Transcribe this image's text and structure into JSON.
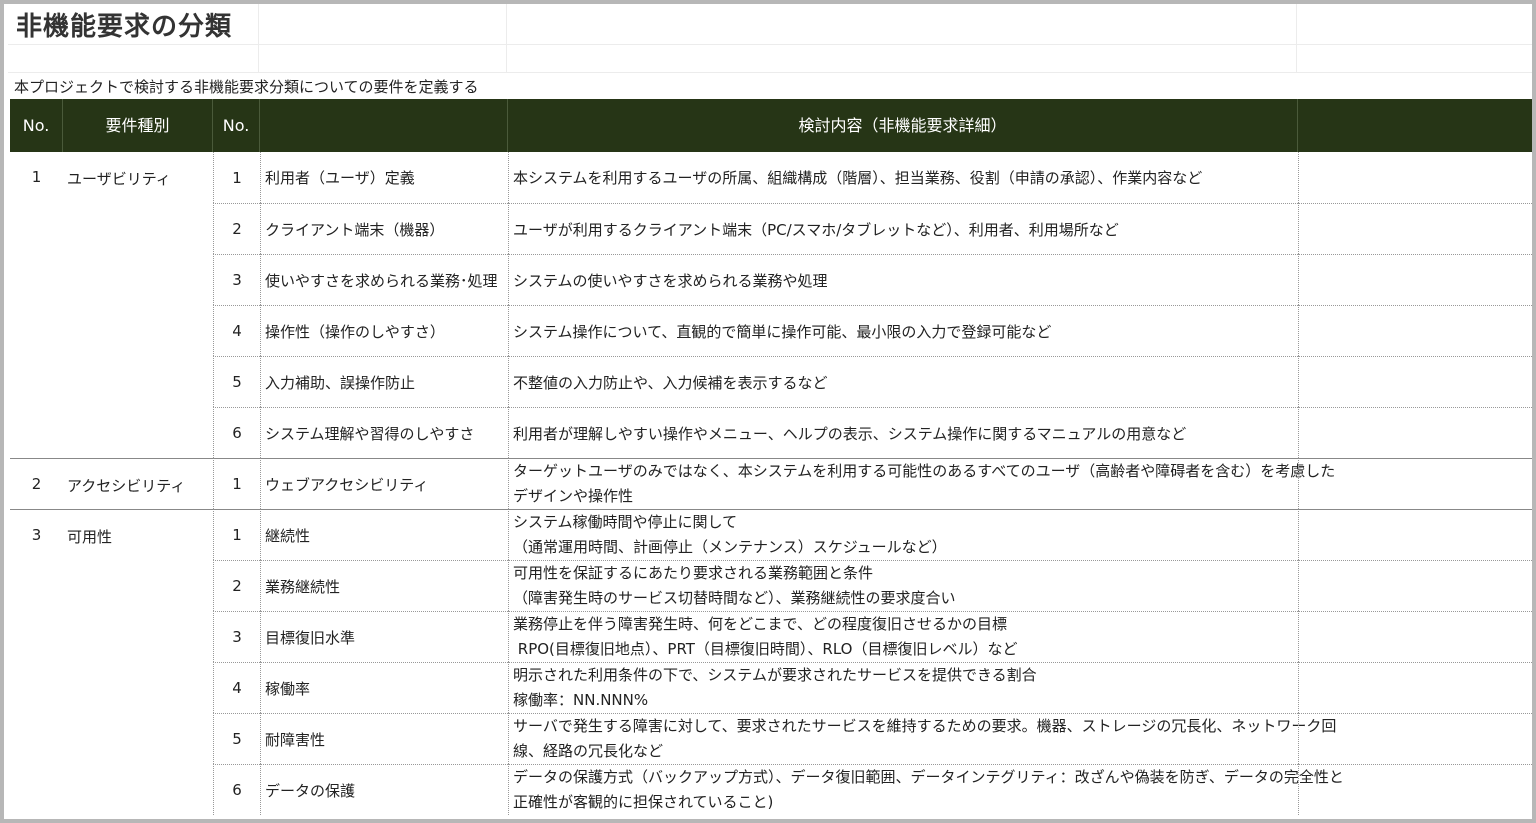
{
  "sheet": {
    "title": "非機能要求の分類",
    "subtitle": "本プロジェクトで検討する非機能要求分類についての要件を定義する"
  },
  "header": {
    "no": "No.",
    "category": "要件種別",
    "sub_no": "No.",
    "item": "",
    "detail": "検討内容（非機能要求詳細）",
    "extra": ""
  },
  "groups": [
    {
      "no": "1",
      "category": "ユーザビリティ",
      "rows": [
        {
          "sub_no": "1",
          "item": "利用者（ユーザ）定義",
          "detail": [
            "本システムを利用するユーザの所属、組織構成（階層）、担当業務、役割（申請の承認）、作業内容など"
          ]
        },
        {
          "sub_no": "2",
          "item": "クライアント端末（機器）",
          "detail": [
            "ユーザが利用するクライアント端末（PC/スマホ/タブレットなど）、利用者、利用場所など"
          ]
        },
        {
          "sub_no": "3",
          "item": "使いやすさを求められる業務･処理",
          "detail": [
            "システムの使いやすさを求められる業務や処理"
          ]
        },
        {
          "sub_no": "4",
          "item": "操作性（操作のしやすさ）",
          "detail": [
            "システム操作について、直観的で簡単に操作可能、最小限の入力で登録可能など"
          ]
        },
        {
          "sub_no": "5",
          "item": "入力補助、誤操作防止",
          "detail": [
            "不整値の入力防止や、入力候補を表示するなど"
          ]
        },
        {
          "sub_no": "6",
          "item": "システム理解や習得のしやすさ",
          "detail": [
            "利用者が理解しやすい操作やメニュー、ヘルプの表示、システム操作に関するマニュアルの用意など"
          ]
        }
      ]
    },
    {
      "no": "2",
      "category": "アクセシビリティ",
      "rows": [
        {
          "sub_no": "1",
          "item": "ウェブアクセシビリティ",
          "detail": [
            "ターゲットユーザのみではなく、本システムを利用する可能性のあるすべてのユーザ（高齢者や障碍者を含む）を考慮した",
            "デザインや操作性"
          ]
        }
      ]
    },
    {
      "no": "3",
      "category": "可用性",
      "rows": [
        {
          "sub_no": "1",
          "item": "継続性",
          "detail": [
            "システム稼働時間や停止に関して",
            "（通常運用時間、計画停止（メンテナンス）スケジュールなど）"
          ]
        },
        {
          "sub_no": "2",
          "item": "業務継続性",
          "detail": [
            "可用性を保証するにあたり要求される業務範囲と条件",
            "（障害発生時のサービス切替時間など）、業務継続性の要求度合い"
          ]
        },
        {
          "sub_no": "3",
          "item": "目標復旧水準",
          "detail": [
            "業務停止を伴う障害発生時、何をどこまで、どの程度復旧させるかの目標",
            " RPO(目標復旧地点）、PRT（目標復旧時間）、RLO（目標復旧レベル）など"
          ]
        },
        {
          "sub_no": "4",
          "item": "稼働率",
          "detail": [
            "明示された利用条件の下で、システムが要求されたサービスを提供できる割合",
            "稼働率：NN.NNN%"
          ]
        },
        {
          "sub_no": "5",
          "item": "耐障害性",
          "detail": [
            "サーバで発生する障害に対して、要求されたサービスを維持するための要求。機器、ストレージの冗長化、ネットワーク回",
            "線、経路の冗長化など"
          ]
        },
        {
          "sub_no": "6",
          "item": "データの保護",
          "detail": [
            "データの保護方式（バックアップ方式）、データ復旧範囲、データインテグリティ：改ざんや偽装を防ぎ、データの完全性と",
            "正確性が客観的に担保されていること)"
          ]
        }
      ]
    }
  ]
}
